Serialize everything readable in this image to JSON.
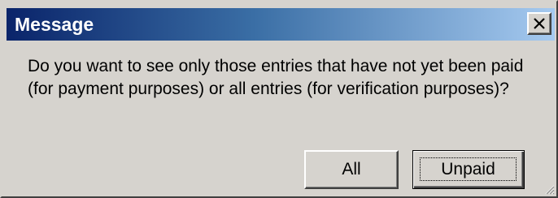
{
  "window": {
    "title": "Message"
  },
  "titlebar": {
    "close_icon": "close-x-icon"
  },
  "message": {
    "text": "Do you want to see only those entries that have not yet been paid\n(for payment purposes) or all entries (for verification purposes)?"
  },
  "buttons": {
    "all_label": "All",
    "unpaid_label": "Unpaid"
  },
  "colors": {
    "dialog_bg": "#d6d3ce",
    "titlebar_start": "#0a246a",
    "titlebar_end": "#a6caf0"
  }
}
